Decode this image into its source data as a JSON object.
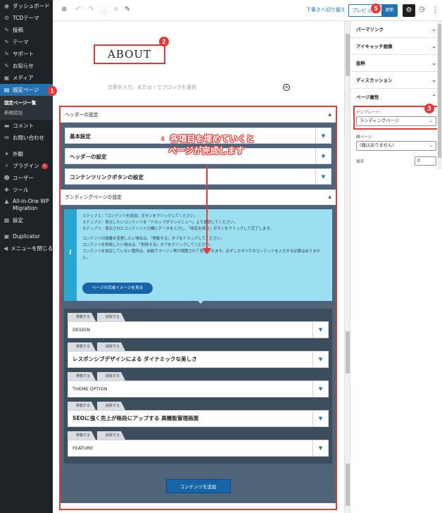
{
  "sidebar": {
    "items": [
      {
        "icon": "dashboard-icon",
        "glyph": "◉",
        "label": "ダッシュボード"
      },
      {
        "icon": "gear-icon",
        "glyph": "⚙",
        "label": "TCDテーマ"
      },
      {
        "icon": "pushpin-icon",
        "glyph": "✎",
        "label": "投稿"
      },
      {
        "icon": "pushpin-icon",
        "glyph": "✎",
        "label": "テーマ"
      },
      {
        "icon": "pushpin-icon",
        "glyph": "✎",
        "label": "サポート"
      },
      {
        "icon": "pushpin-icon",
        "glyph": "✎",
        "label": "お知らせ"
      },
      {
        "icon": "media-icon",
        "glyph": "▣",
        "label": "メディア"
      },
      {
        "icon": "pages-icon",
        "glyph": "▤",
        "label": "固定ページ"
      }
    ],
    "submenu": [
      "固定ページ一覧",
      "新規追加"
    ],
    "items2": [
      {
        "icon": "comment-icon",
        "glyph": "▬",
        "label": "コメント"
      },
      {
        "icon": "mail-icon",
        "glyph": "✉",
        "label": "お問い合わせ"
      },
      {
        "icon": "appearance-icon",
        "glyph": "✦",
        "label": "外観"
      },
      {
        "icon": "plugin-icon",
        "glyph": "⚡",
        "label": "プラグイン"
      },
      {
        "icon": "users-icon",
        "glyph": "☻",
        "label": "ユーザー"
      },
      {
        "icon": "tools-icon",
        "glyph": "✚",
        "label": "ツール"
      },
      {
        "icon": "migration-icon",
        "glyph": "▲",
        "label": "All-in-One WP Migration"
      },
      {
        "icon": "settings-icon",
        "glyph": "▦",
        "label": "設定"
      },
      {
        "icon": "duplicator-icon",
        "glyph": "▣",
        "label": "Duplicator"
      },
      {
        "icon": "collapse-icon",
        "glyph": "◀",
        "label": "メニューを閉じる"
      }
    ],
    "plugin_badge": "1"
  },
  "toolbar": {
    "draft_label": "下書きへ切り替え",
    "preview_label": "プレビュー",
    "update_label": "更新"
  },
  "editor": {
    "title": "ABOUT",
    "placeholder": "文章を入力、または / でブロックを選択"
  },
  "header_settings": {
    "title": "ヘッダーの設定",
    "rows": [
      "基本設定",
      "ヘッダーの設定",
      "コンテンツリンクボタンの設定"
    ]
  },
  "landing": {
    "title": "ランディングページの設定",
    "info_lines": [
      "ステップ１：「コンテンツを追加」ボタンをクリックしてください。",
      "ステップ２：表示したいコンテンツを「ドロップダウンメニュー」より選択してください。",
      "ステップ３：表示されたコンテンツ入力欄にデータを入力し、「設定を保存」ボタンをクリックして完了します。",
      "",
      "コンテンツの順番を変更したい場合は、「移動する」タブをドラッグしてください。",
      "コンテンツを削除したい場合は、「削除する」タブをクリックしてください。",
      "コンテンツを設定していない箇所は、自動でマージン等が調整されて表示されます。必ずしもすべてのコンテンツを入力する必要はありませ",
      "ん。"
    ],
    "info_button": "ページの完成イメージを見る",
    "move_label": "移動する",
    "delete_label": "削除する",
    "contents": [
      {
        "label": "DESIGN",
        "big": false
      },
      {
        "label": "レスポンシブデザインによる ダイナミックな美しさ",
        "big": true
      },
      {
        "label": "THEME OPTION",
        "big": false
      },
      {
        "label": "SEOに強く売上が格段にアップする 高機能管理画面",
        "big": true
      },
      {
        "label": "FEATURE",
        "big": false
      }
    ],
    "add_button": "コンテンツを追加"
  },
  "annotation": {
    "m1": "1",
    "m2": "2",
    "m3": "3",
    "m4": "4",
    "m5": "5",
    "callout_line1": "各項目を埋めていくと",
    "callout_line2": "ページが完成します"
  },
  "panel": {
    "sections": [
      "パーマリンク",
      "アイキャッチ画像",
      "抜粋",
      "ディスカッション"
    ],
    "attr_title": "ページ属性",
    "template_label": "テンプレート:",
    "template_value": "ランディングページ",
    "parent_label": "親ページ:",
    "parent_value": "(親はありません)",
    "order_label": "順序",
    "order_value": "0"
  },
  "colors": {
    "accent": "#2271b1",
    "annotation": "#e53935",
    "admin_bg": "#1d2327"
  }
}
